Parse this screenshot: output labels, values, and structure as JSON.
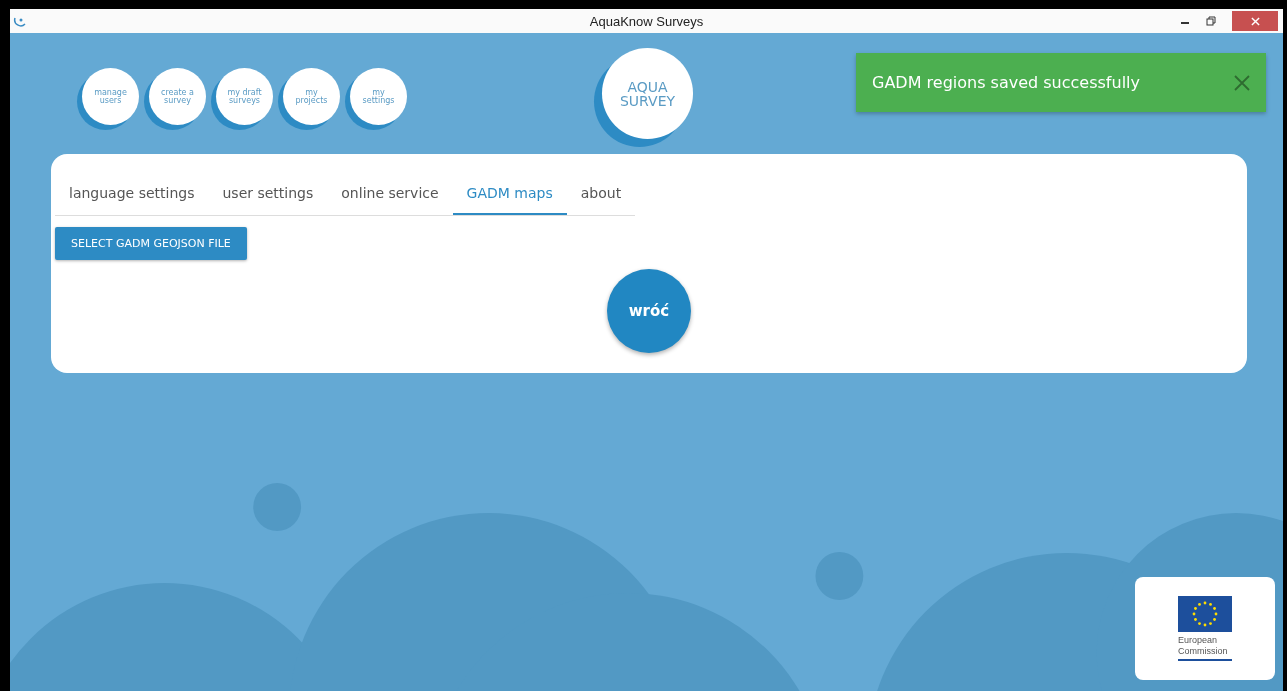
{
  "window": {
    "title": "AquaKnow Surveys"
  },
  "nav": [
    {
      "label": "manage users"
    },
    {
      "label": "create a survey"
    },
    {
      "label": "my draft surveys"
    },
    {
      "label": "my projects"
    },
    {
      "label": "my settings"
    }
  ],
  "logo": {
    "lines": [
      "AQUA",
      "SURVEY"
    ]
  },
  "toast": {
    "message": "GADM regions saved successfully"
  },
  "tabs": [
    {
      "label": "language settings",
      "selected": false
    },
    {
      "label": "user settings",
      "selected": false
    },
    {
      "label": "online service",
      "selected": false
    },
    {
      "label": "GADM maps",
      "selected": true
    },
    {
      "label": "about",
      "selected": false
    }
  ],
  "select_button": {
    "label": "SELECT GADM GEOJSON FILE"
  },
  "back_button": {
    "label": "wróć"
  },
  "eu_logo": {
    "lines": [
      "European",
      "Commission"
    ]
  }
}
